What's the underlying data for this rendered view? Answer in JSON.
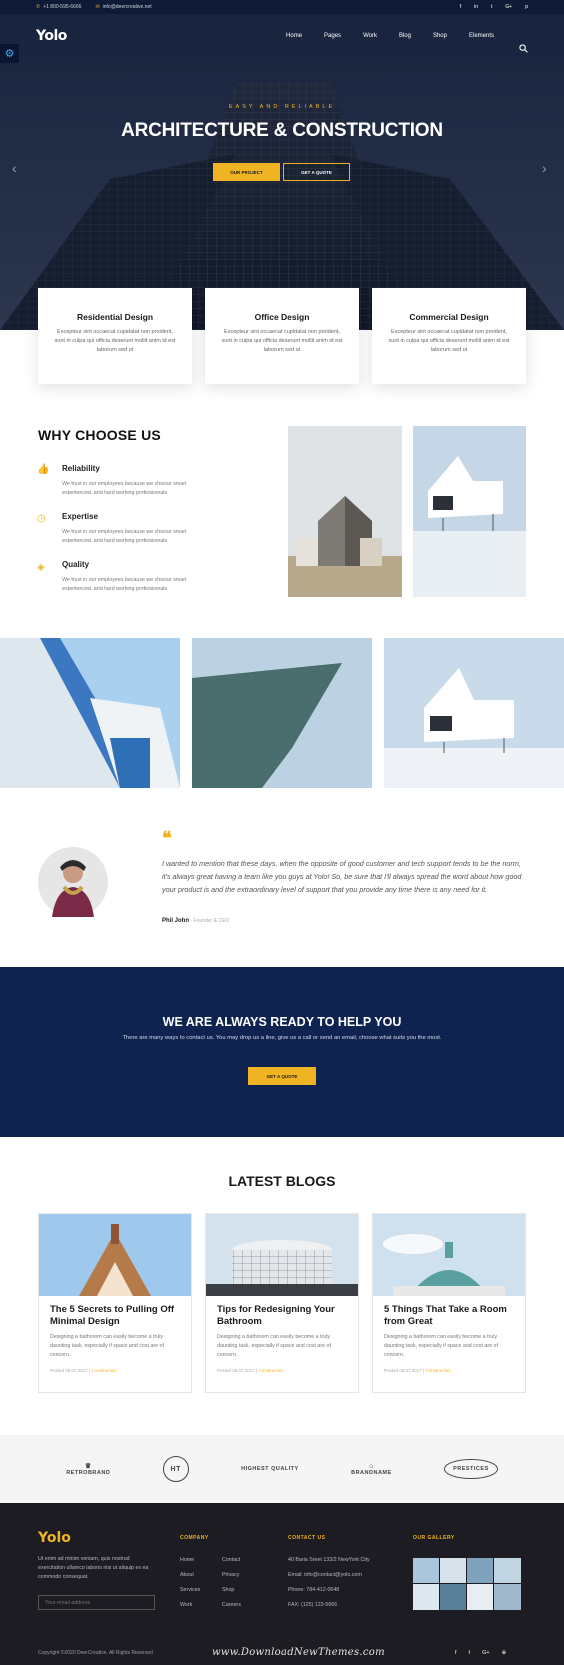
{
  "topbar": {
    "phone": "+1 800-595-6666",
    "email": "info@deercreative.net",
    "social": [
      "f",
      "in",
      "t",
      "G+",
      "p"
    ]
  },
  "nav": {
    "logo": "Yolo",
    "items": [
      "Home",
      "Pages",
      "Work",
      "Blog",
      "Shop",
      "Elements"
    ]
  },
  "hero": {
    "eyebrow": "EASY AND RELIABLE",
    "title": "ARCHITECTURE & CONSTRUCTION",
    "primary_button": "OUR PROJECT",
    "secondary_button": "GET A QUOTE"
  },
  "services": [
    {
      "title": "Residential Design",
      "text": "Excepteur sint occaecat cupidatat non proident, sunt in culpa qui officia deserunt mollit anim id est laborum sed ut"
    },
    {
      "title": "Office Design",
      "text": "Excepteur sint occaecat cupidatat non proident, sunt in culpa qui officia deserunt mollit anim id est laborum sed ut"
    },
    {
      "title": "Commercial Design",
      "text": "Excepteur sint occaecat cupidatat non proident, sunt in culpa qui officia deserunt mollit anim id est laborum sed ut"
    }
  ],
  "why": {
    "heading": "WHY CHOOSE US",
    "features": [
      {
        "title": "Reliability",
        "text": "We trust in our employees because we choose smart experienced, and hard working professionals",
        "icon": "thumbs-up-icon"
      },
      {
        "title": "Expertise",
        "text": "We trust in our employees because we choose smart experienced, and hard working professionals",
        "icon": "clock-icon"
      },
      {
        "title": "Quality",
        "text": "We trust in our employees because we choose smart experienced, and hard working professionals",
        "icon": "diamond-icon"
      }
    ]
  },
  "testimonial": {
    "quote": "I wanted to mention that these days, when the opposite of good customer and tech support tends to be the norm, it's always great having a team like you guys at Yolo! So, be sure that I'll always spread the word about how good your product is and the extraordinary level of support that you provide any time there is any need for it.",
    "name": "Phil John",
    "role": "- Founder & CEO"
  },
  "cta": {
    "heading": "WE ARE ALWAYS READY TO HELP YOU",
    "text": "There are many ways to contact us. You may drop us a line, give us a call or send an email, choose what suits you the most.",
    "button": "GET A QUOTE"
  },
  "blogs": {
    "heading": "LATEST BLOGS",
    "posts": [
      {
        "title": "The 5 Secrets to Pulling Off Minimal Design",
        "excerpt": "Designing a bathroom can easily become a truly daunting task, especially if space and cost are of concern.",
        "date": "Posted 08.07.2017 | ",
        "category": "Construction"
      },
      {
        "title": "Tips for Redesigning Your Bathroom",
        "excerpt": "Designing a bathroom can easily become a truly daunting task, especially if space and cost are of concern.",
        "date": "Posted 08.07.2017 | ",
        "category": "Construction"
      },
      {
        "title": "5 Things That Take a Room from Great",
        "excerpt": "Designing a bathroom can easily become a truly daunting task, especially if space and cost are of concern.",
        "date": "Posted 08.07.2017 | ",
        "category": "Construction"
      }
    ]
  },
  "brands": [
    "RETROBRAND",
    "HT",
    "HIGHEST QUALITY",
    "BRANDNAME",
    "PRESTICES"
  ],
  "footer": {
    "logo": "Yolo",
    "about": "Ut enim ad minim veniam, quis nostrud exercitation ullamco laboris nisi ut aliquip ex ea commodo consequat.",
    "email_placeholder": "Your email address",
    "company_heading": "COMPANY",
    "company_col1": [
      "Home",
      "About",
      "Services",
      "Work"
    ],
    "company_col2": [
      "Contact",
      "Privacy",
      "Shop",
      "Careers"
    ],
    "contact_heading": "CONTACT US",
    "contact": [
      "40 Baria Sreet 133/2 NewYork City",
      "Email: info@contact@yolo.com",
      "Phone: 784-412-0648",
      "FAX: (125) 123-5666"
    ],
    "gallery_heading": "OUR GALLERY",
    "copyright": "Copyright ©2020 DeerCreative. All Rights Reserved",
    "social": [
      "f",
      "t",
      "G+",
      "⊕"
    ]
  },
  "watermark": "www.DownloadNewThemes.com",
  "colors": {
    "accent": "#f0b323",
    "navy": "#0f2351",
    "footer": "#1c1c22"
  }
}
